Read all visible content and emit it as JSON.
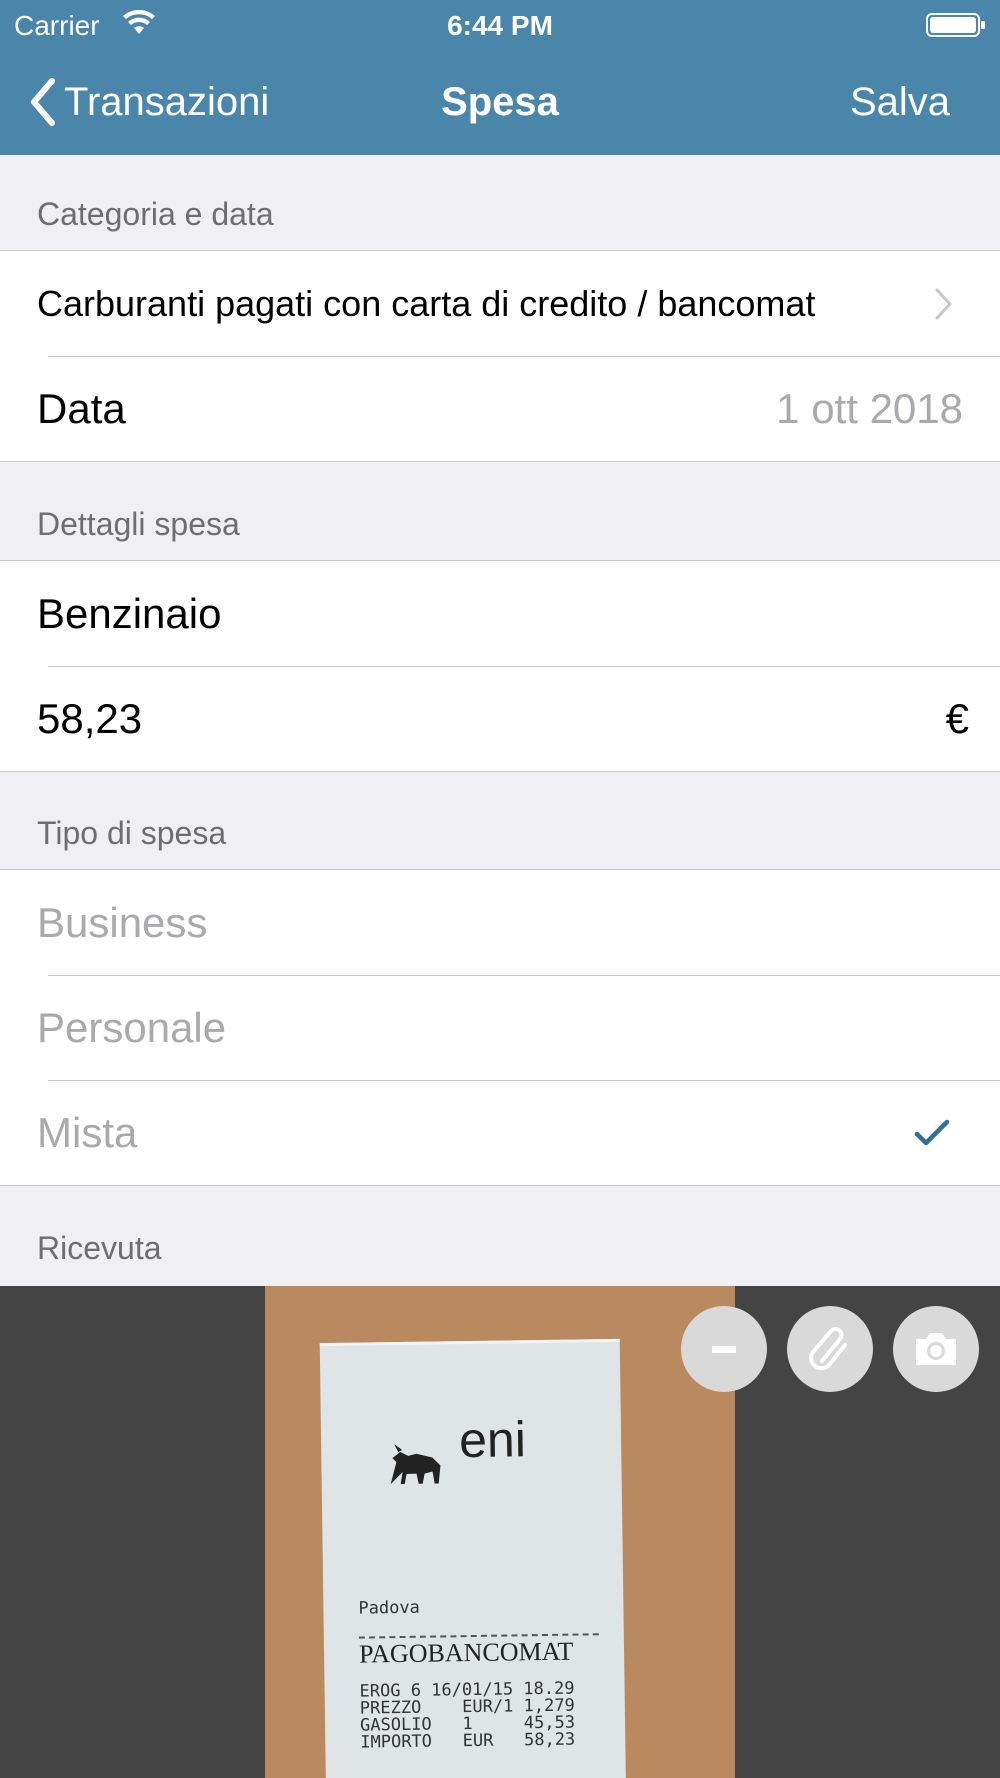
{
  "status_bar": {
    "carrier": "Carrier",
    "time": "6:44 PM"
  },
  "nav": {
    "back_label": "Transazioni",
    "title": "Spesa",
    "save_label": "Salva"
  },
  "sections": {
    "category_date": {
      "header": "Categoria e data",
      "category": "Carburanti pagati con carta di credito / bancomat",
      "date_label": "Data",
      "date_value": "1 ott 2018"
    },
    "details": {
      "header": "Dettagli spesa",
      "merchant": "Benzinaio",
      "amount": "58,23",
      "currency": "€"
    },
    "expense_type": {
      "header": "Tipo di spesa",
      "options": [
        "Business",
        "Personale",
        "Mista"
      ],
      "selected": "Mista"
    },
    "receipt": {
      "header": "Ricevuta",
      "text": {
        "brand": "eni",
        "city": "Padova",
        "payment": "PAGOBANCOMAT",
        "lines": [
          "EROG 6 16/01/15 18.29",
          "PREZZO    EUR/1 1,279",
          "GASOLIO   1     45,53",
          "IMPORTO   EUR   58,23"
        ]
      }
    }
  },
  "icons": {
    "back": "chevron-left-icon",
    "disclosure": "chevron-right-icon",
    "check": "checkmark-icon",
    "remove": "minus-icon",
    "attach": "paperclip-icon",
    "camera": "camera-icon"
  },
  "colors": {
    "nav_bar": "#4986aa",
    "background": "#efeff4",
    "check": "#2f6f99",
    "muted_text": "#a9a9ae",
    "receipt_bg": "#444444"
  }
}
